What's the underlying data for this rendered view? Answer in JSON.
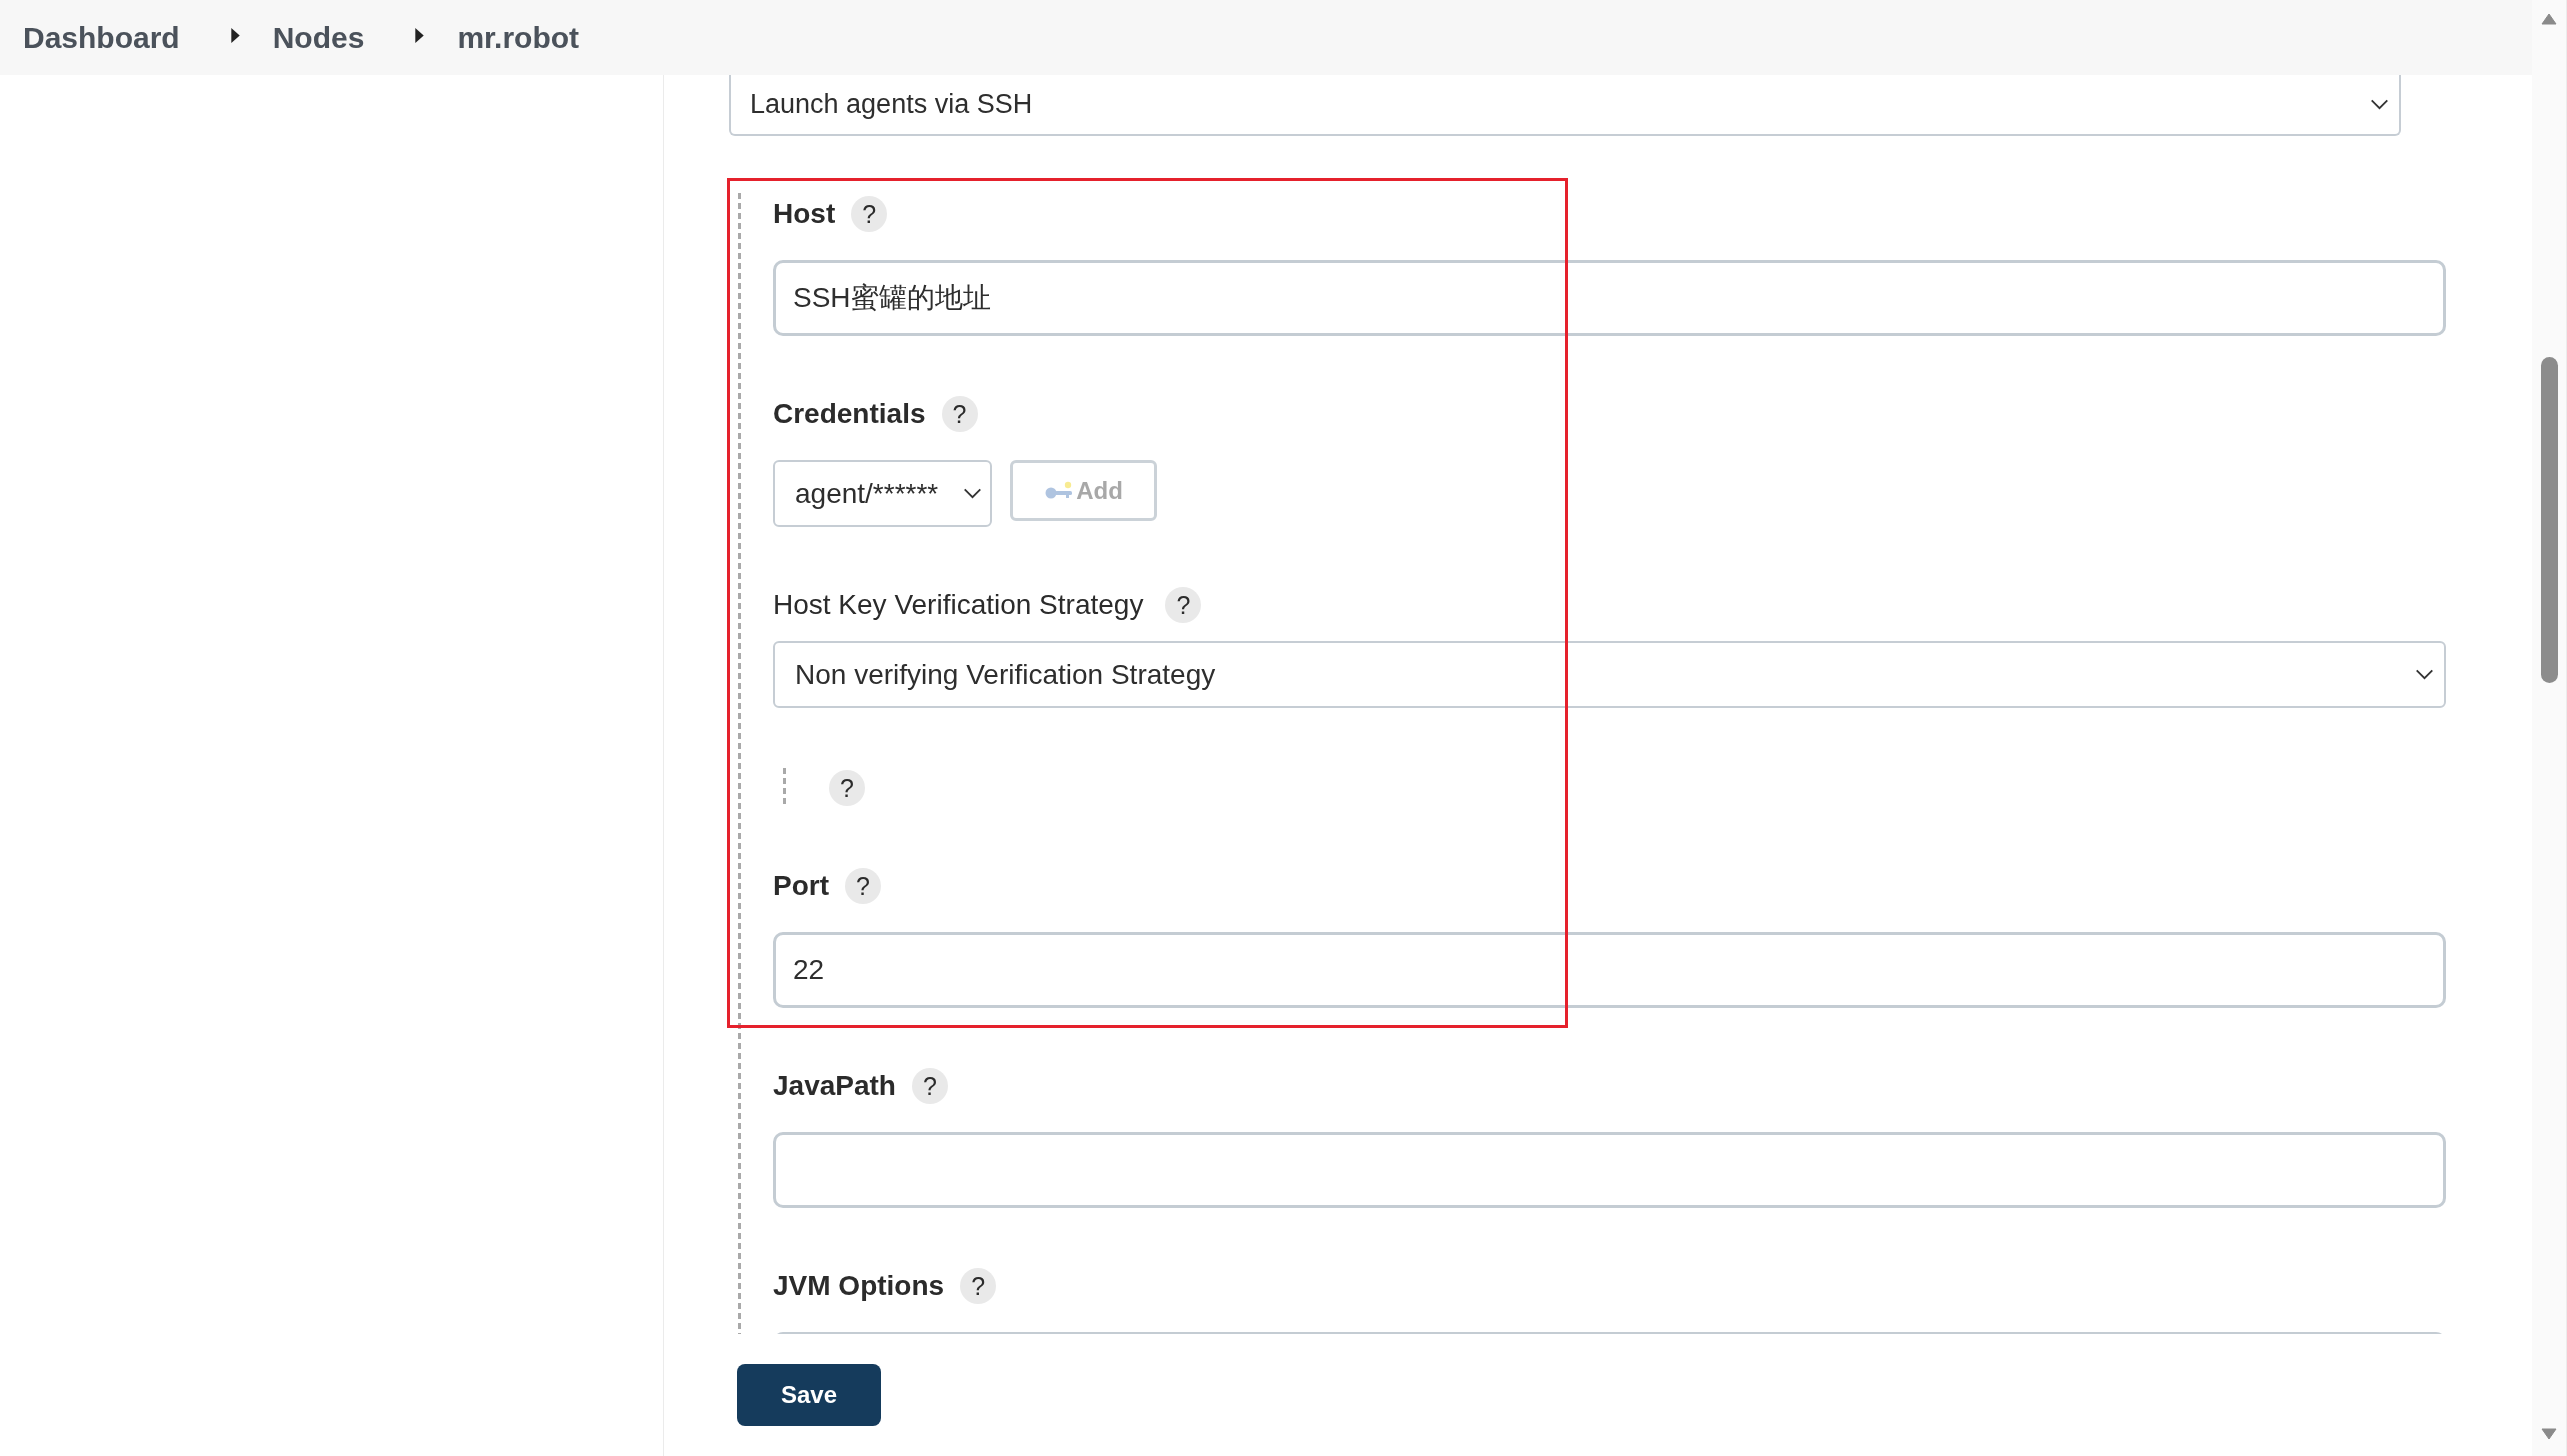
{
  "breadcrumbs": [
    {
      "label": "Dashboard"
    },
    {
      "label": "Nodes"
    },
    {
      "label": "mr.robot"
    }
  ],
  "launch_method": {
    "value": "Launch agents via SSH"
  },
  "highlighted_fields": [
    {
      "kind": "text",
      "label": "Host",
      "help": "?",
      "value": "SSH蜜罐的地址"
    },
    {
      "kind": "credentials",
      "label": "Credentials",
      "help": "?",
      "value": "agent/******",
      "add_button": {
        "label": "Add",
        "disabled": true
      }
    },
    {
      "kind": "select",
      "label": "Host Key Verification Strategy",
      "help": "?",
      "value": "Non verifying Verification Strategy"
    },
    {
      "kind": "help_only",
      "help": "?"
    },
    {
      "kind": "text",
      "label": "Port",
      "help": "?",
      "value": "22"
    }
  ],
  "fields": [
    {
      "kind": "text",
      "label": "JavaPath",
      "help": "?"
    },
    {
      "kind": "text",
      "label": "JVM Options",
      "help": "?"
    }
  ],
  "save_button": {
    "label": "Save"
  }
}
